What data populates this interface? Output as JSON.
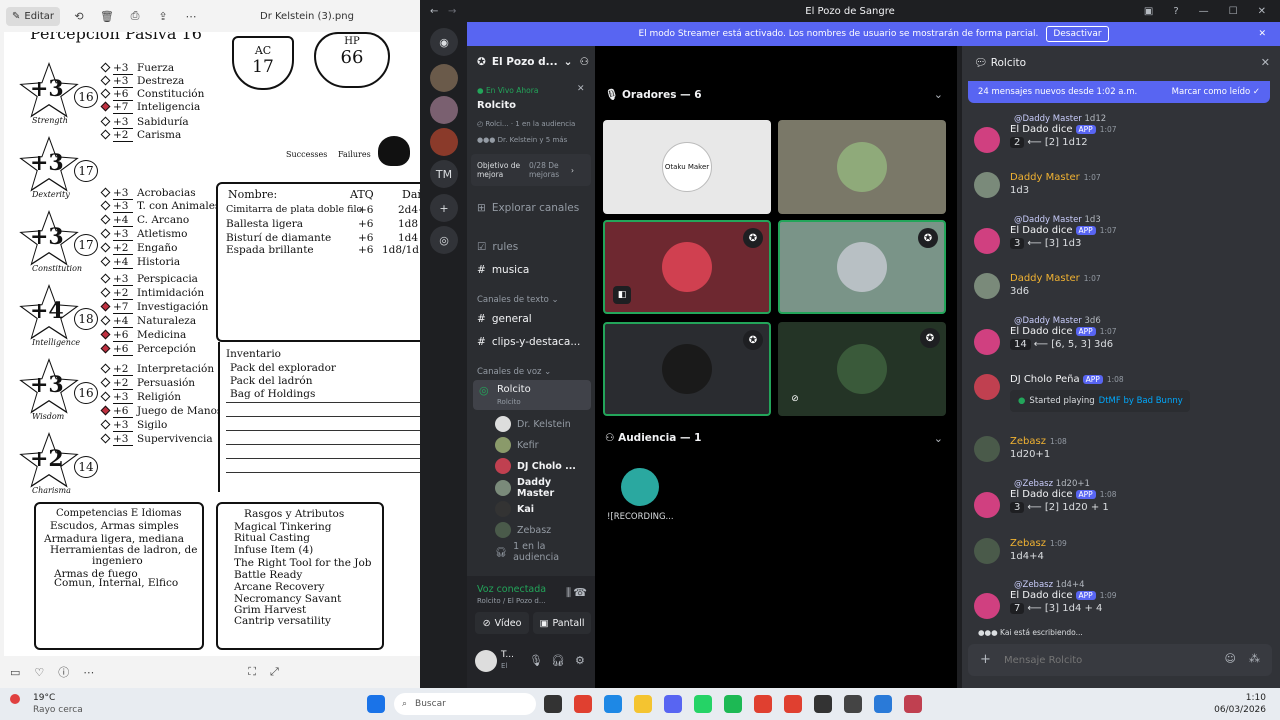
{
  "viewer": {
    "edit_label": "Editar",
    "filename": "Dr Kelstein (3).png"
  },
  "sheet": {
    "header": "Percepción Pasiva 16",
    "ac_label": "AC",
    "ac_value": "17",
    "hp_label": "HP",
    "hp_value": "66",
    "successes_label": "Successes",
    "failures_label": "Failures",
    "stats": [
      {
        "name": "Strength",
        "mod": "+3",
        "score": "16"
      },
      {
        "name": "Dexterity",
        "mod": "+3",
        "score": "17"
      },
      {
        "name": "Constitution",
        "mod": "+3",
        "score": "17"
      },
      {
        "name": "Intelligence",
        "mod": "+4",
        "score": "18"
      },
      {
        "name": "Wisdom",
        "mod": "+3",
        "score": "16"
      },
      {
        "name": "Charisma",
        "mod": "+2",
        "score": "14"
      }
    ],
    "skills": [
      {
        "mod": "+3",
        "name": "Fuerza"
      },
      {
        "mod": "+3",
        "name": "Destreza"
      },
      {
        "mod": "+6",
        "name": "Constitución"
      },
      {
        "mod": "+7",
        "name": "Inteligencia"
      },
      {
        "mod": "+3",
        "name": "Sabiduría"
      },
      {
        "mod": "+2",
        "name": "Carisma"
      },
      {
        "mod": "+3",
        "name": "Acrobacias"
      },
      {
        "mod": "+3",
        "name": "T. con Animales"
      },
      {
        "mod": "+4",
        "name": "C. Arcano"
      },
      {
        "mod": "+3",
        "name": "Atletismo"
      },
      {
        "mod": "+2",
        "name": "Engaño"
      },
      {
        "mod": "+4",
        "name": "Historia"
      },
      {
        "mod": "+3",
        "name": "Perspicacia"
      },
      {
        "mod": "+2",
        "name": "Intimidación"
      },
      {
        "mod": "+7",
        "name": "Investigación"
      },
      {
        "mod": "+4",
        "name": "Naturaleza"
      },
      {
        "mod": "+6",
        "name": "Medicina"
      },
      {
        "mod": "+6",
        "name": "Percepción"
      },
      {
        "mod": "+2",
        "name": "Interpretación"
      },
      {
        "mod": "+2",
        "name": "Persuasión"
      },
      {
        "mod": "+3",
        "name": "Religión"
      },
      {
        "mod": "+6",
        "name": "Juego de Manos"
      },
      {
        "mod": "+3",
        "name": "Sigilo"
      },
      {
        "mod": "+3",
        "name": "Supervivencia"
      }
    ],
    "attacks_headers": [
      "Nombre:",
      "ATQ",
      "Dañ"
    ],
    "attacks": [
      {
        "name": "Cimitarra de plata doble filo",
        "atk": "+6",
        "dmg": "2d4+"
      },
      {
        "name": "Ballesta ligera",
        "atk": "+6",
        "dmg": "1d8"
      },
      {
        "name": "Bisturí de diamante",
        "atk": "+6",
        "dmg": "1d4"
      },
      {
        "name": "Espada brillante",
        "atk": "+6",
        "dmg": "1d8/1d"
      }
    ],
    "inventory_title": "Inventario",
    "inventory": [
      "Pack del explorador",
      "Pack del ladrón",
      "Bag of Holdings"
    ],
    "competencies_title": "Competencias E Idiomas",
    "competencies": [
      "Escudos, Armas simples",
      "Armadura ligera, mediana",
      "Herramientas de ladron, de",
      "ingeniero",
      "Armas de fuego",
      "Comun, Internal, Elfico"
    ],
    "traits_title": "Rasgos y Atributos",
    "traits": [
      "Magical Tinkering",
      "Ritual Casting",
      "Infuse Item (4)",
      "The Right Tool for the Job",
      "Battle Ready",
      "Arcane Recovery",
      "Necromancy Savant",
      "Grim Harvest",
      "Cantrip versatility"
    ]
  },
  "discord": {
    "window_title": "El Pozo de Sangre",
    "banner_text": "El modo Streamer está activado. Los nombres de usuario se mostrarán de forma parcial.",
    "banner_button": "Desactivar",
    "server_name": "El Pozo d...",
    "live_label": "En Vivo Ahora",
    "live_channel": "Rolcito",
    "live_sub": "Rolci...",
    "live_audience": "1 en la audiencia",
    "live_speakers": "Dr. Kelstein y 5 más",
    "goal_label": "Objetivo de mejora",
    "goal_value": "0/28 De mejoras",
    "explore": "Explorar canales",
    "channels_top": [
      "rules",
      "musica"
    ],
    "text_cat": "Canales de texto",
    "text_channels": [
      "general",
      "clips-y-destaca..."
    ],
    "voice_cat": "Canales de voz",
    "voice_channel": "Rolcito",
    "voice_channel_sub": "Rolcito",
    "voice_users": [
      "Dr. Kelstein",
      "Kefir",
      "DJ Cholo ...",
      "Daddy Master",
      "Kai",
      "Zebasz"
    ],
    "voice_audience": "1 en la audiencia",
    "voice_connected": "Voz conectada",
    "voice_connected_sub": "Rolcito / El Pozo d...",
    "video_btn": "Vídeo",
    "screen_btn": "Pantall",
    "user_short": "T...",
    "user_sub": "El",
    "speakers_title": "Oradores — 6",
    "audience_title": "Audiencia — 1",
    "audience_member": "![RECORDING...",
    "tile_text": "Otaku Maker",
    "chat_channel": "Rolcito",
    "new_msgs": "24 mensajes nuevos desde 1:02 a.m.",
    "mark_read": "Marcar como leído",
    "messages": [
      {
        "reply_to": "@Daddy Master",
        "reply_text": "1d12",
        "user": "El Dado dice",
        "app": "APP",
        "time": "1:07",
        "roll": "2",
        "text": "⟵ [2] 1d12"
      },
      {
        "user": "Daddy Master",
        "time": "1:07",
        "text": "1d3"
      },
      {
        "reply_to": "@Daddy Master",
        "reply_text": "1d3",
        "user": "El Dado dice",
        "app": "APP",
        "time": "1:07",
        "roll": "3",
        "text": "⟵ [3] 1d3"
      },
      {
        "user": "Daddy Master",
        "time": "1:07",
        "text": "3d6"
      },
      {
        "reply_to": "@Daddy Master",
        "reply_text": "3d6",
        "user": "El Dado dice",
        "app": "APP",
        "time": "1:07",
        "roll": "14",
        "text": "⟵ [6, 5, 3] 3d6"
      },
      {
        "user": "DJ Cholo Peña",
        "app": "APP",
        "time": "1:08",
        "activity_prefix": "Started playing",
        "activity": "DtMF by Bad Bunny"
      },
      {
        "user": "Zebasz",
        "time": "1:08",
        "text": "1d20+1"
      },
      {
        "reply_to": "@Zebasz",
        "reply_text": "1d20+1",
        "user": "El Dado dice",
        "app": "APP",
        "time": "1:08",
        "roll": "3",
        "text": "⟵ [2] 1d20 + 1"
      },
      {
        "user": "Zebasz",
        "time": "1:09",
        "text": "1d4+4"
      },
      {
        "reply_to": "@Zebasz",
        "reply_text": "1d4+4",
        "user": "El Dado dice",
        "app": "APP",
        "time": "1:09",
        "roll": "7",
        "text": "⟵ [3] 1d4 + 4"
      }
    ],
    "typing": "Kai está escribiendo...",
    "input_placeholder": "Mensaje Rolcito"
  },
  "taskbar": {
    "temp": "19°C",
    "weather": "Rayo cerca",
    "search_placeholder": "Buscar",
    "time": "1:10",
    "date": "06/03/2026"
  },
  "colors": {
    "accent": "#5865f2",
    "live": "#23a55a",
    "speaking": "#23a55a",
    "name_orange": "#f0b232"
  }
}
